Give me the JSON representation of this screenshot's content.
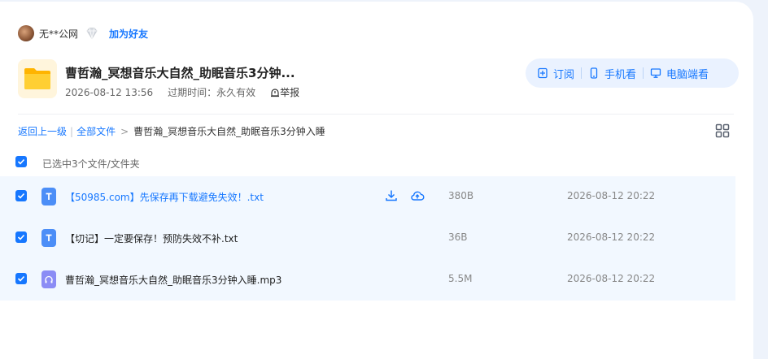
{
  "sharer": {
    "name": "无**公网",
    "add_friend": "加为好友"
  },
  "share": {
    "title": "曹哲瀚_冥想音乐大自然_助眠音乐3分钟...",
    "date": "2026-08-12 13:56",
    "expire_label": "过期时间：",
    "expire_value": "永久有效",
    "report": "举报"
  },
  "actions": {
    "subscribe": "订阅",
    "mobile": "手机看",
    "desktop": "电脑端看"
  },
  "breadcrumb": {
    "back": "返回上一级",
    "all_files": "全部文件",
    "separator": ">",
    "current": "曹哲瀚_冥想音乐大自然_助眠音乐3分钟入睡"
  },
  "selection": {
    "text": "已选中3个文件/文件夹"
  },
  "colors": {
    "accent": "#1677ff",
    "row_highlight": "#f2f8ff",
    "folder": "#ffc928",
    "txt_icon": "#4c8ef7",
    "mp3_icon": "#8b8cf5"
  },
  "files": [
    {
      "name": "【50985.com】先保存再下载避免失效！.txt",
      "size": "380B",
      "date": "2026-08-12 20:22",
      "type": "txt",
      "icon": "text-file-icon",
      "checked": true
    },
    {
      "name": "【切记】一定要保存！预防失效不补.txt",
      "size": "36B",
      "date": "2026-08-12 20:22",
      "type": "txt",
      "icon": "text-file-icon",
      "checked": true
    },
    {
      "name": "曹哲瀚_冥想音乐大自然_助眠音乐3分钟入睡.mp3",
      "size": "5.5M",
      "date": "2026-08-12 20:22",
      "type": "mp3",
      "icon": "audio-file-icon",
      "checked": true
    }
  ]
}
